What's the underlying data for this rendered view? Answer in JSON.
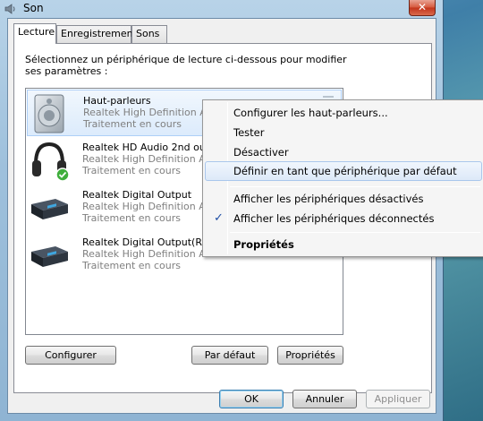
{
  "window": {
    "title": "Son",
    "close_label": "✕"
  },
  "tabs": [
    {
      "label": "Lecture",
      "active": true
    },
    {
      "label": "Enregistrement",
      "active": false
    },
    {
      "label": "Sons",
      "active": false
    }
  ],
  "instruction": "Sélectionnez un périphérique de lecture ci-dessous pour modifier ses paramètres :",
  "devices": [
    {
      "name": "Haut-parleurs",
      "line1": "Realtek High Definition Audio",
      "line2": "Traitement en cours",
      "icon": "speaker-icon",
      "selected": true
    },
    {
      "name": "Realtek HD Audio 2nd output",
      "line1": "Realtek High Definition Audio",
      "line2": "Traitement en cours",
      "icon": "headphones-icon",
      "selected": false
    },
    {
      "name": "Realtek Digital Output",
      "line1": "Realtek High Definition Audio",
      "line2": "Traitement en cours",
      "icon": "digital-output-icon",
      "selected": false
    },
    {
      "name": "Realtek Digital Output(RCA)",
      "line1": "Realtek High Definition Audio",
      "line2": "Traitement en cours",
      "icon": "digital-output-icon",
      "selected": false
    }
  ],
  "buttons": {
    "configure": "Configurer",
    "set_default": "Par défaut",
    "properties": "Propriétés",
    "ok": "OK",
    "cancel": "Annuler",
    "apply": "Appliquer"
  },
  "context_menu": {
    "items": [
      {
        "label": "Configurer les haut-parleurs..."
      },
      {
        "label": "Tester"
      },
      {
        "label": "Désactiver"
      },
      {
        "label": "Définir en tant que périphérique par défaut",
        "highlighted": true
      },
      {
        "label": "Afficher les périphériques désactivés"
      },
      {
        "label": "Afficher les périphériques déconnectés",
        "checked": true
      },
      {
        "label": "Propriétés",
        "bold": true
      }
    ],
    "check_glyph": "✓"
  }
}
